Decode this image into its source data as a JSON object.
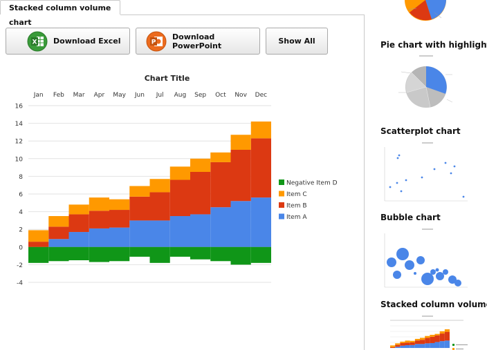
{
  "tab": {
    "label": "Stacked column volume chart"
  },
  "buttons": {
    "excel": "Download Excel",
    "powerpoint": "Download PowerPoint",
    "show_all": "Show All"
  },
  "icons": {
    "excel": "excel-icon",
    "powerpoint": "powerpoint-icon"
  },
  "colors": {
    "item_a": "#4a86e8",
    "item_b": "#dc3912",
    "item_c": "#ff9900",
    "negative_d": "#109618"
  },
  "chart_data": {
    "type": "bar",
    "stacked": true,
    "title": "Chart Title",
    "categories": [
      "Jan",
      "Feb",
      "Mar",
      "Apr",
      "May",
      "Jun",
      "Jul",
      "Aug",
      "Sep",
      "Oct",
      "Nov",
      "Dec"
    ],
    "ylim": [
      -4,
      16
    ],
    "yticks": [
      -4,
      -2,
      0,
      2,
      4,
      6,
      8,
      10,
      12,
      14,
      16
    ],
    "grid": true,
    "legend_position": "right",
    "series": [
      {
        "name": "Item A",
        "color": "#4a86e8",
        "values": [
          0.0,
          0.9,
          1.7,
          2.1,
          2.2,
          3.0,
          3.0,
          3.5,
          3.7,
          4.5,
          5.2,
          5.6
        ]
      },
      {
        "name": "Item B",
        "color": "#dc3912",
        "values": [
          0.6,
          1.4,
          2.0,
          2.0,
          2.0,
          2.7,
          3.2,
          4.1,
          4.8,
          5.1,
          5.8,
          6.7
        ]
      },
      {
        "name": "Item C",
        "color": "#ff9900",
        "values": [
          1.3,
          1.2,
          1.1,
          1.5,
          1.2,
          1.2,
          1.5,
          1.5,
          1.5,
          1.1,
          1.7,
          1.9
        ]
      },
      {
        "name": "Negative Item D",
        "color": "#109618",
        "values": [
          -1.8,
          -1.6,
          -1.5,
          -1.7,
          -1.6,
          -1.1,
          -1.8,
          -1.1,
          -1.4,
          -1.6,
          -2.0,
          -1.8
        ]
      }
    ]
  },
  "sidebar": {
    "items": [
      {
        "title": "Pie chart with highlight"
      },
      {
        "title": "Scatterplot chart"
      },
      {
        "title": "Bubble chart"
      },
      {
        "title": "Stacked column volume chart"
      }
    ]
  }
}
